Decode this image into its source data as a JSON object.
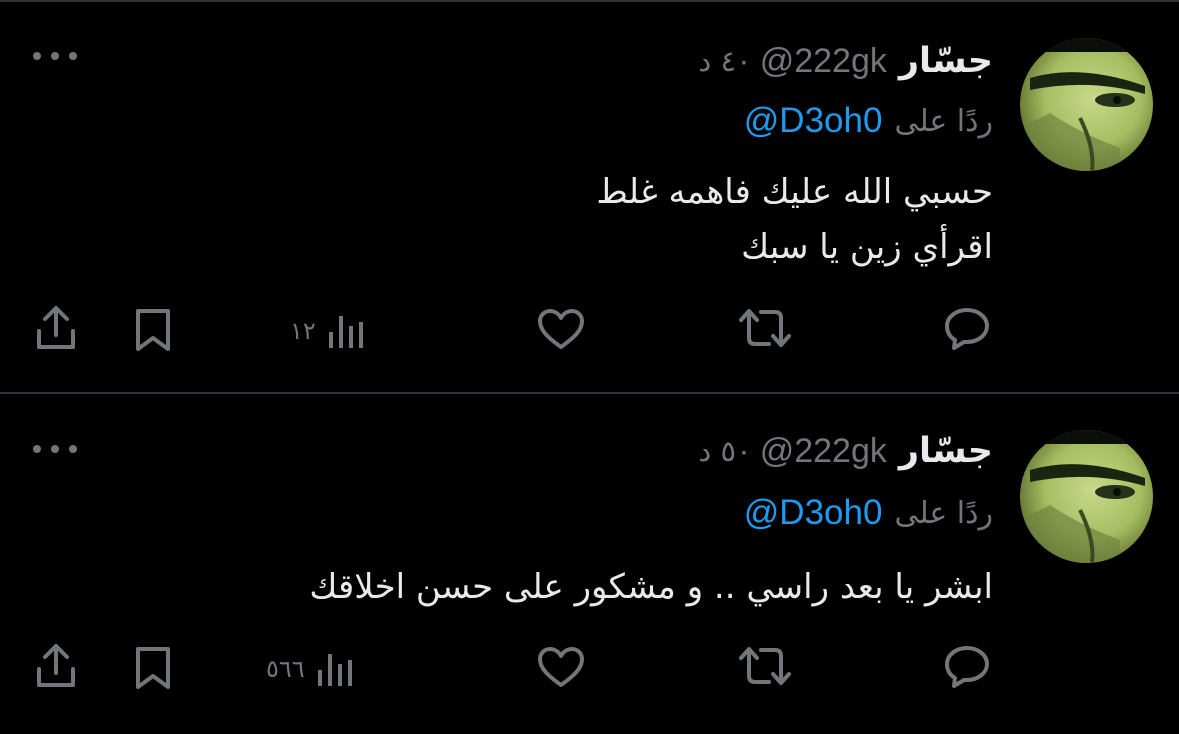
{
  "colors": {
    "background": "#000000",
    "text": "#e7e9ea",
    "secondary": "#71767b",
    "link": "#1d9bf0",
    "divider": "#2f3336"
  },
  "tweets": [
    {
      "display_name": "جسّار",
      "handle": "@222gk",
      "time": "٤٠ د",
      "reply_prefix": "ردًا على",
      "reply_to": "@D3oh0",
      "text": "حسبي الله عليك فاهمه غلط\nاقرأي زين يا سبك",
      "views": "١٢",
      "icons": [
        "more-icon",
        "reply-icon",
        "retweet-icon",
        "like-icon",
        "views-icon",
        "bookmark-icon",
        "share-icon"
      ]
    },
    {
      "display_name": "جسّار",
      "handle": "@222gk",
      "time": "٥٠ د",
      "reply_prefix": "ردًا على",
      "reply_to": "@D3oh0",
      "text": "ابشر يا بعد راسي .. و مشكور على حسن اخلاقك",
      "views": "٥٦٦",
      "icons": [
        "more-icon",
        "reply-icon",
        "retweet-icon",
        "like-icon",
        "views-icon",
        "bookmark-icon",
        "share-icon"
      ]
    }
  ]
}
